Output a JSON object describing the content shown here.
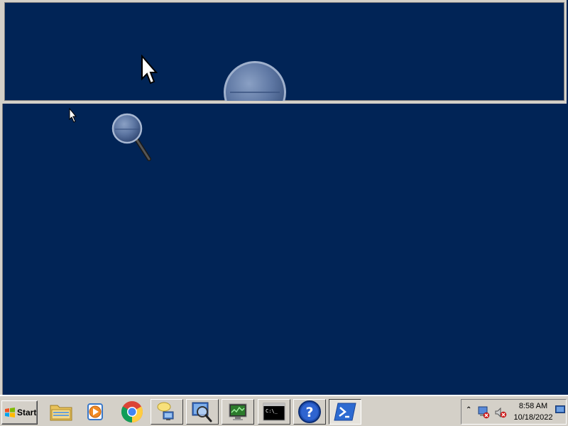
{
  "taskbar": {
    "start_label": "Start",
    "pinned": [
      {
        "name": "windows-explorer",
        "icon": "folder-icon"
      },
      {
        "name": "media-player",
        "icon": "media-player-icon"
      },
      {
        "name": "google-chrome",
        "icon": "chrome-icon"
      },
      {
        "name": "network-sharing",
        "icon": "network-icon"
      },
      {
        "name": "magnifier",
        "icon": "magnifier-icon"
      },
      {
        "name": "performance-monitor",
        "icon": "monitor-icon"
      },
      {
        "name": "command-prompt",
        "icon": "cmd-icon"
      },
      {
        "name": "help",
        "icon": "help-icon"
      },
      {
        "name": "powershell",
        "icon": "powershell-icon"
      }
    ]
  },
  "tray": {
    "time": "8:58 AM",
    "date": "10/18/2022"
  },
  "colors": {
    "desktop_bg": "#012456",
    "taskbar_bg": "#d4d0c8"
  }
}
